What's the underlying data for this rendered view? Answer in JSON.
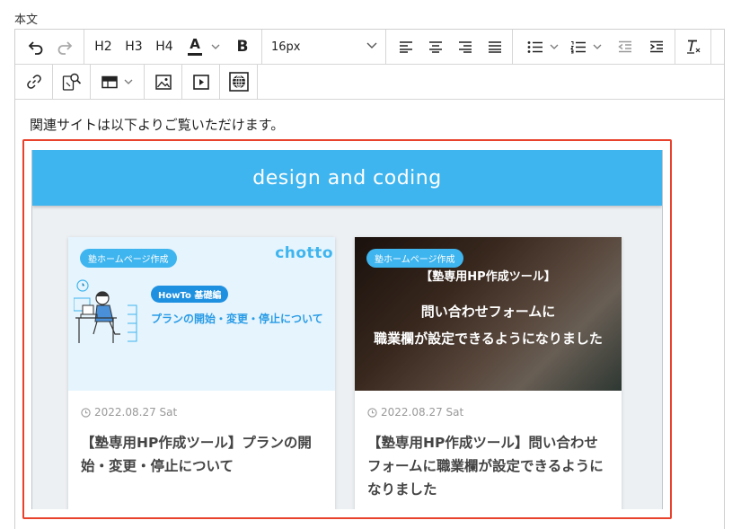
{
  "field": {
    "label": "本文"
  },
  "toolbar": {
    "h2": "H2",
    "h3": "H3",
    "h4": "H4",
    "font_color_label": "A",
    "bold_label": "B",
    "font_size": "16px"
  },
  "content": {
    "intro": "関連サイトは以下よりご覧いただけます。"
  },
  "embed": {
    "header": "design and coding",
    "cards": [
      {
        "tag": "塾ホームページ作成",
        "logo": "chotto",
        "sub_tag": "HowTo 基礎編",
        "thumb_title": "プランの開始・変更・停止について",
        "date": "2022.08.27 Sat",
        "title": "【塾専用HP作成ツール】プランの開始・変更・停止について"
      },
      {
        "tag": "塾ホームページ作成",
        "overlay_line1": "【塾専用HP作成ツール】",
        "overlay_line2": "問い合わせフォームに",
        "overlay_line3": "職業欄が設定できるようになりました",
        "date": "2022.08.27 Sat",
        "title": "【塾専用HP作成ツール】問い合わせフォームに職業欄が設定できるようになりました"
      }
    ]
  },
  "colors": {
    "accent": "#3fb5ef",
    "highlight_border": "#e8412c"
  }
}
